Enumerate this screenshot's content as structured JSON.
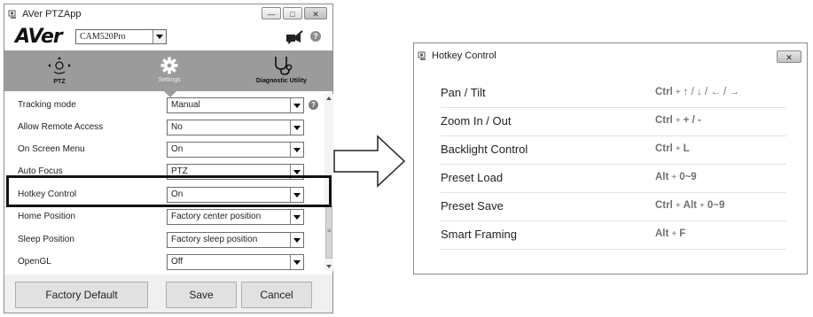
{
  "left_window": {
    "title": "AVer PTZApp",
    "logo": "AVer",
    "model": "CAM520Pro",
    "nav": [
      {
        "label": "PTZ"
      },
      {
        "label": "Settings"
      },
      {
        "label": "Diagnostic Utility"
      }
    ],
    "settings": [
      {
        "label": "Tracking mode",
        "value": "Manual"
      },
      {
        "label": "Allow Remote Access",
        "value": "No"
      },
      {
        "label": "On Screen Menu",
        "value": "On"
      },
      {
        "label": "Auto Focus",
        "value": "PTZ"
      },
      {
        "label": "Hotkey Control",
        "value": "On"
      },
      {
        "label": "Home Position",
        "value": "Factory center position"
      },
      {
        "label": "Sleep Position",
        "value": "Factory sleep position"
      },
      {
        "label": "OpenGL",
        "value": "Off"
      }
    ],
    "buttons": {
      "factory_default": "Factory Default",
      "save": "Save",
      "cancel": "Cancel"
    }
  },
  "hotkey_window": {
    "title": "Hotkey Control",
    "rows": [
      {
        "function": "Pan / Tilt",
        "keys": [
          "Ctrl",
          "+",
          "↑ / ↓ / ← / →"
        ]
      },
      {
        "function": "Zoom In / Out",
        "keys": [
          "Ctrl",
          "+",
          "+ / -"
        ]
      },
      {
        "function": "Backlight Control",
        "keys": [
          "Ctrl",
          "+",
          "L"
        ]
      },
      {
        "function": "Preset Load",
        "keys": [
          "Alt",
          "+",
          "0~9"
        ]
      },
      {
        "function": "Preset Save",
        "keys": [
          "Ctrl",
          "+",
          "Alt",
          "+",
          "0~9"
        ]
      },
      {
        "function": "Smart Framing",
        "keys": [
          "Alt",
          "+",
          "F"
        ]
      }
    ]
  }
}
